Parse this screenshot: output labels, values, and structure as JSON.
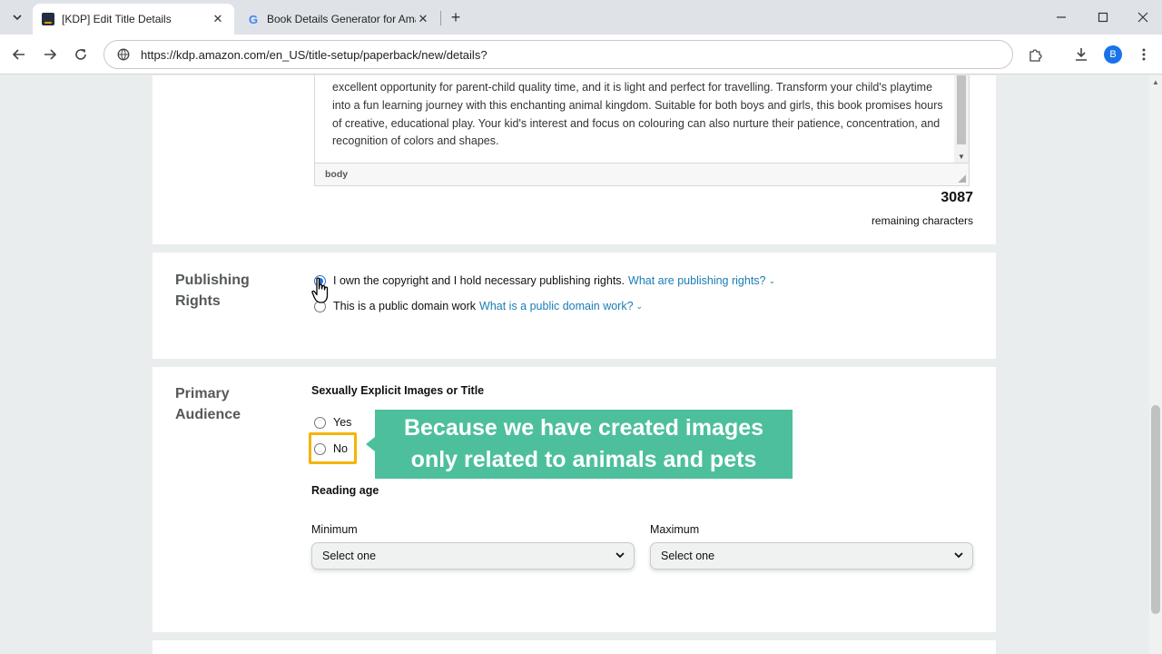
{
  "browser": {
    "tabs": [
      {
        "title": "[KDP] Edit Title Details",
        "active": true,
        "icon": "amazon-favicon"
      },
      {
        "title": "Book Details Generator for Ama",
        "active": false,
        "icon": "google-favicon"
      }
    ],
    "url": "https://kdp.amazon.com/en_US/title-setup/paperback/new/details?",
    "profile_initial": "B"
  },
  "description": {
    "text": "excellent opportunity for parent-child quality time, and it is light and perfect for travelling. Transform your child's playtime into a fun learning journey with this enchanting animal kingdom. Suitable for both boys and girls, this book promises hours of creative, educational play. Your kid's interest and focus on colouring can also nurture their patience, concentration, and recognition of colors and shapes.",
    "status_path": "body",
    "remaining_count": "3087",
    "remaining_label": "remaining characters"
  },
  "publishing_rights": {
    "title": "Publishing Rights",
    "option_own": "I own the copyright and I hold necessary publishing rights.",
    "option_own_link": "What are publishing rights?",
    "option_own_selected": true,
    "option_public": "This is a public domain work",
    "option_public_link": "What is a public domain work?",
    "option_public_selected": false
  },
  "primary_audience": {
    "title": "Primary Audience",
    "explicit_label": "Sexually Explicit Images or Title",
    "yes_label": "Yes",
    "no_label": "No",
    "reading_age_label": "Reading age",
    "minimum_label": "Minimum",
    "maximum_label": "Maximum",
    "minimum_value": "Select one",
    "maximum_value": "Select one"
  },
  "callout": {
    "line1": "Because we have created images",
    "line2": "only related to animals and pets",
    "color": "#4dbf9c"
  },
  "colors": {
    "highlight": "#f4b400",
    "link": "#1a7db5",
    "radio_selected": "#2a6ad6"
  }
}
